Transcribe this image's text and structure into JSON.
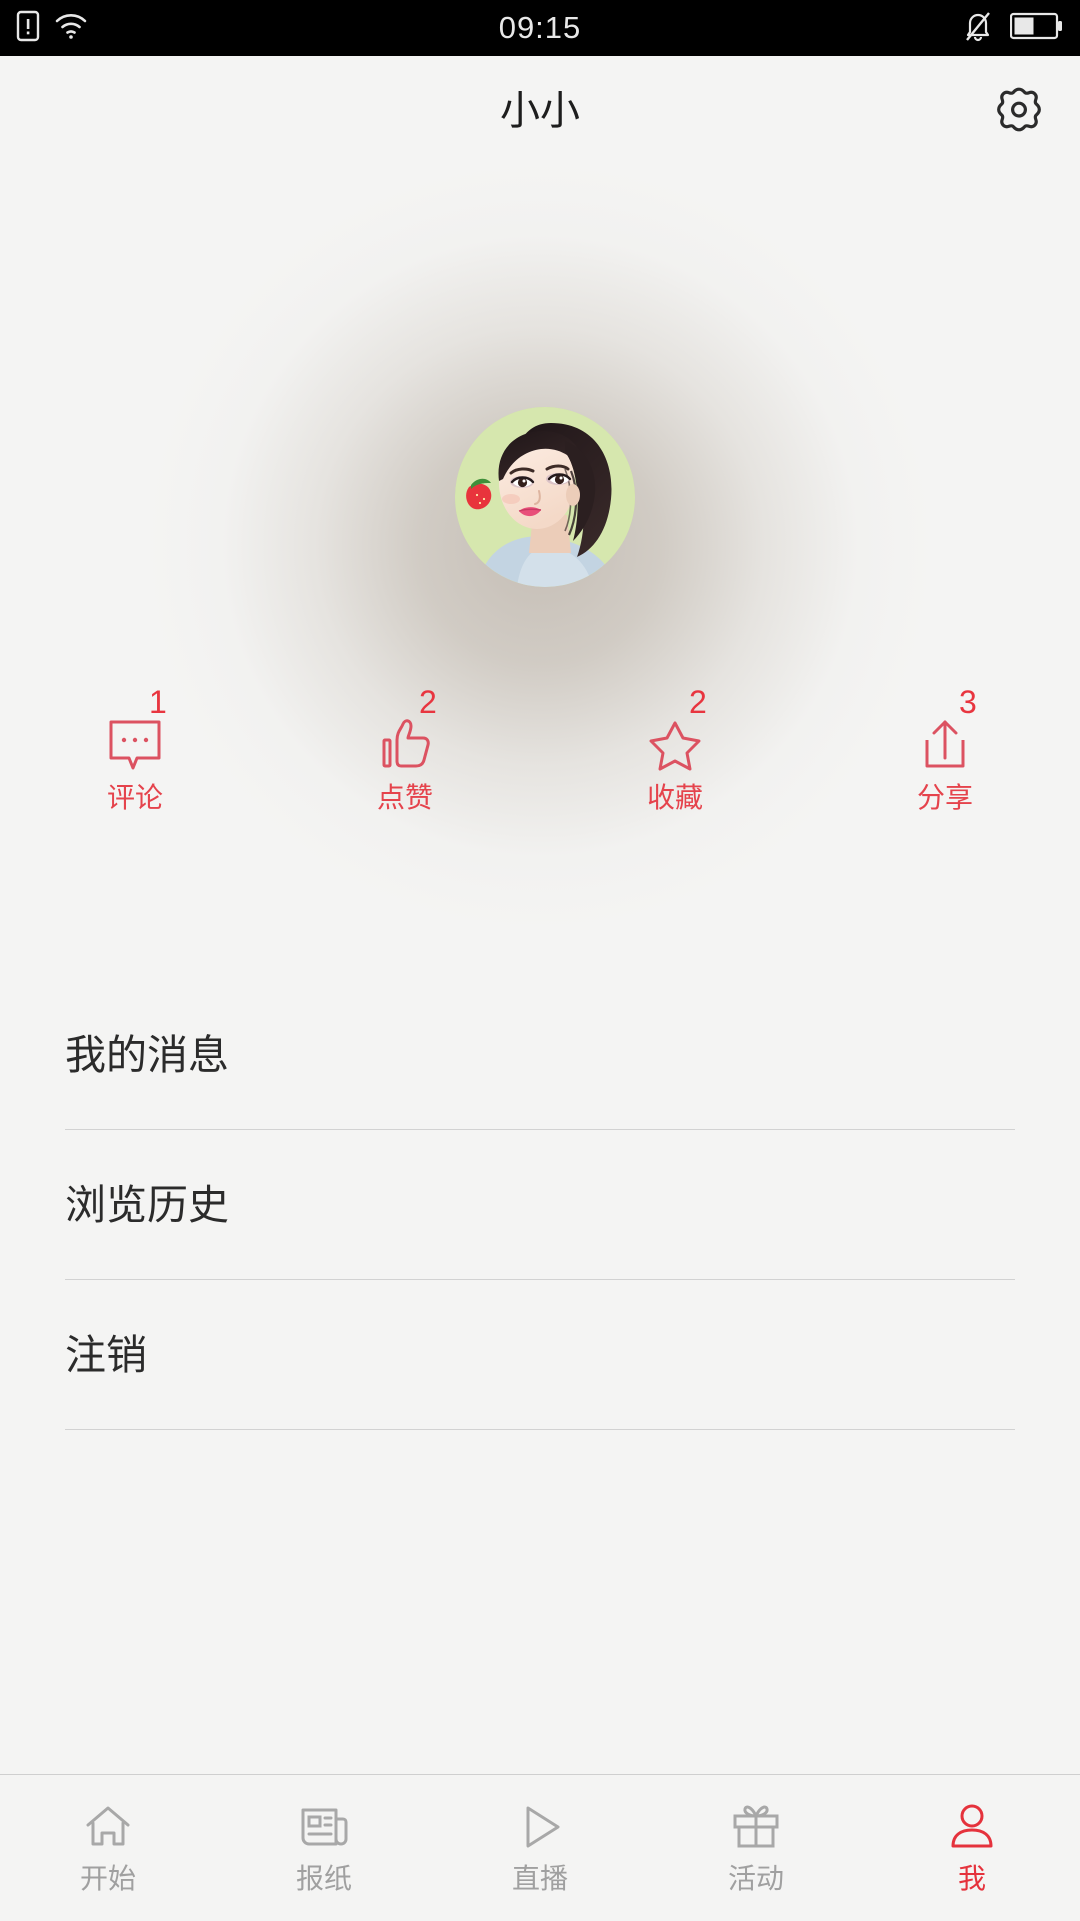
{
  "status_bar": {
    "time": "09:15",
    "left_icons": [
      "sim-card-alert-icon",
      "wifi-icon"
    ],
    "right_icons": [
      "bell-muted-icon",
      "battery-icon"
    ],
    "background_color": "#000000",
    "text_color": "#e8e8e8"
  },
  "header": {
    "title": "小小",
    "settings_icon": "gear-icon"
  },
  "profile": {
    "avatar_icon": "user-avatar-photo",
    "avatar_background_color": "#cfe0a8"
  },
  "stats": {
    "accent_color": "#e5434c",
    "items": [
      {
        "label": "评论",
        "count": "1",
        "icon": "comment-bubble-icon"
      },
      {
        "label": "点赞",
        "count": "2",
        "icon": "thumbs-up-icon"
      },
      {
        "label": "收藏",
        "count": "2",
        "icon": "star-outline-icon"
      },
      {
        "label": "分享",
        "count": "3",
        "icon": "share-upload-icon"
      }
    ]
  },
  "menu": {
    "items": [
      {
        "label": "我的消息"
      },
      {
        "label": "浏览历史"
      },
      {
        "label": "注销"
      }
    ]
  },
  "bottom_nav": {
    "inactive_color": "#a0a0a0",
    "active_color": "#e5323c",
    "items": [
      {
        "label": "开始",
        "icon": "home-icon",
        "active": false
      },
      {
        "label": "报纸",
        "icon": "newspaper-icon",
        "active": false
      },
      {
        "label": "直播",
        "icon": "play-triangle-icon",
        "active": false
      },
      {
        "label": "活动",
        "icon": "gift-icon",
        "active": false
      },
      {
        "label": "我",
        "icon": "person-icon",
        "active": true
      }
    ]
  },
  "theme": {
    "page_background": "#f4f4f3",
    "divider_color": "#d2d2d2",
    "title_color": "#1d1d1d"
  }
}
